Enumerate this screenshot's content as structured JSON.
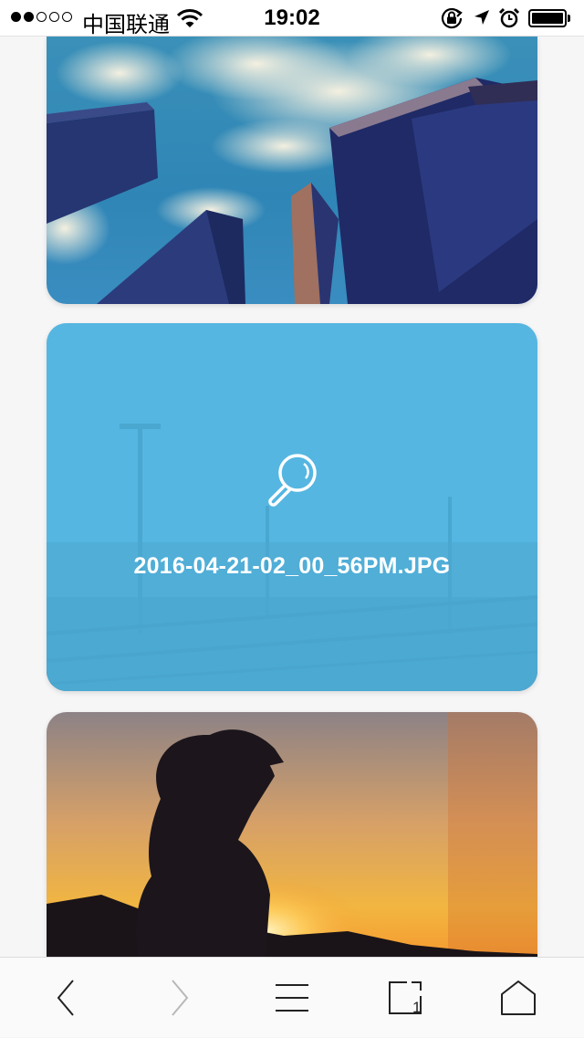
{
  "status_bar": {
    "carrier": "中国联通",
    "time": "19:02",
    "signal_bars_filled": 2,
    "signal_bars_total": 5,
    "battery_level": 1.0
  },
  "gallery": {
    "items": [
      {
        "kind": "image",
        "subject": "skyscrapers-looking-up"
      },
      {
        "kind": "image",
        "subject": "railway-station",
        "filename": "2016-04-21-02_00_56PM.JPG",
        "overlay_color": "#4eb6e2",
        "overlay_icon": "search-icon"
      },
      {
        "kind": "image",
        "subject": "woman-silhouette-sunset"
      }
    ]
  },
  "toolbar": {
    "buttons": [
      {
        "name": "back",
        "icon": "chevron-left-icon",
        "enabled": true
      },
      {
        "name": "forward",
        "icon": "chevron-right-icon",
        "enabled": false
      },
      {
        "name": "menu",
        "icon": "hamburger-icon",
        "enabled": true
      },
      {
        "name": "tabs",
        "icon": "tabs-icon",
        "badge": "1",
        "enabled": true
      },
      {
        "name": "home",
        "icon": "home-icon",
        "enabled": true
      }
    ]
  },
  "colors": {
    "accent_overlay": "#4eb6e2",
    "toolbar_icon": "#222222",
    "toolbar_icon_disabled": "#b8b8b8",
    "page_background": "#f6f6f7"
  }
}
